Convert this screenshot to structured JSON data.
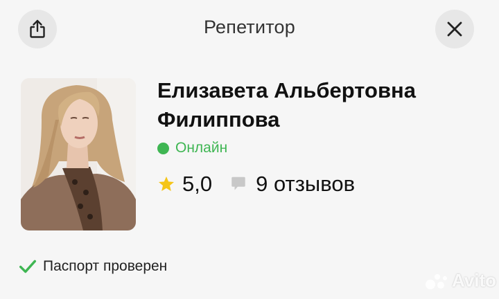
{
  "header": {
    "title": "Репетитор",
    "share_icon": "share-icon",
    "close_icon": "close-icon"
  },
  "profile": {
    "name_line1": "Елизавета Альбертовна",
    "name_line2": "Филиппова",
    "status": "Онлайн",
    "rating": "5,0",
    "reviews": "9 отзывов",
    "status_color": "#3fb653",
    "star_color": "#f5c518"
  },
  "verification": {
    "label": "Паспорт проверен",
    "check_color": "#3fb653"
  },
  "watermark": {
    "text": "Avito"
  }
}
